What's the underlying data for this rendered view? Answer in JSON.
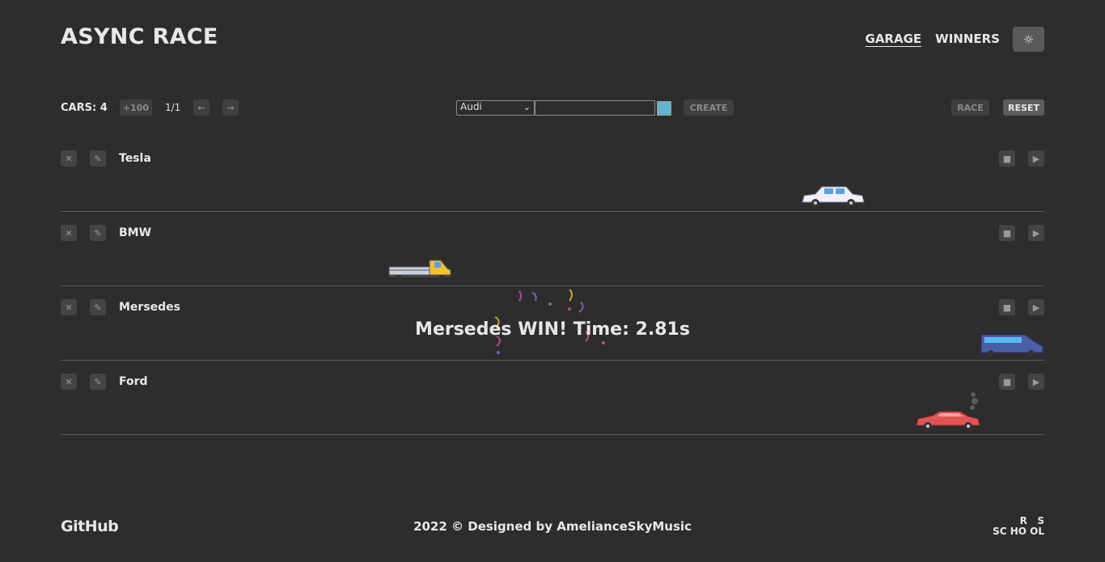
{
  "app": {
    "title": "ASYNC RACE"
  },
  "nav": {
    "garage": "GARAGE",
    "winners": "WINNERS",
    "theme_icon": "sun-icon"
  },
  "toolbar": {
    "cars_label": "CARS: 4",
    "generate_label": "+100",
    "page_info": "1/1",
    "prev_label": "←",
    "next_label": "→",
    "brand_selected": "Audi",
    "model_value": "",
    "color_value": "#64b5cd",
    "create_label": "CREATE",
    "race_label": "RACE",
    "reset_label": "RESET"
  },
  "tracks": [
    {
      "name": "Tesla",
      "car_color": "#f0f0f8",
      "car_type": "sedan-icon"
    },
    {
      "name": "BMW",
      "car_color": "#f1c232",
      "car_type": "truck-icon"
    },
    {
      "name": "Mersedes",
      "car_color": "#4a5fa8",
      "car_type": "van-icon"
    },
    {
      "name": "Ford",
      "car_color": "#e05555",
      "car_type": "sport-car-icon"
    }
  ],
  "track_buttons": {
    "delete": "✕",
    "edit": "✎",
    "stop": "■",
    "start": "▶"
  },
  "win_message": "Mersedes WIN! Time: 2.81s",
  "footer": {
    "github": "GitHub",
    "copyright": "2022 © Designed by AmelianceSkyMusic",
    "school_line1": "R   S",
    "school_line2": "SC HO OL"
  }
}
